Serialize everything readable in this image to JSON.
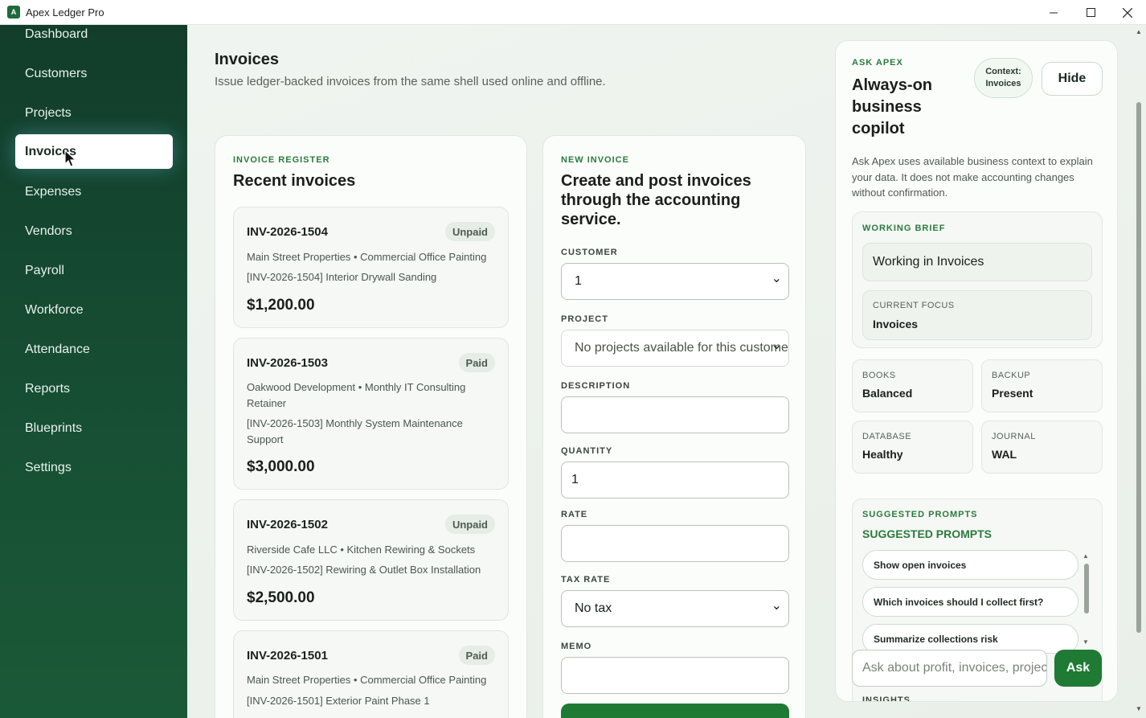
{
  "window": {
    "title": "Apex Ledger Pro",
    "icon_letter": "A"
  },
  "sidebar": {
    "items": [
      {
        "label": "Dashboard"
      },
      {
        "label": "Customers"
      },
      {
        "label": "Projects"
      },
      {
        "label": "Invoices",
        "active": true
      },
      {
        "label": "Expenses"
      },
      {
        "label": "Vendors"
      },
      {
        "label": "Payroll"
      },
      {
        "label": "Workforce"
      },
      {
        "label": "Attendance"
      },
      {
        "label": "Reports"
      },
      {
        "label": "Blueprints"
      },
      {
        "label": "Settings"
      }
    ]
  },
  "header": {
    "title": "Invoices",
    "subtitle": "Issue ledger-backed invoices from the same shell used online and offline."
  },
  "register": {
    "eyebrow": "INVOICE REGISTER",
    "title": "Recent invoices",
    "invoices": [
      {
        "number": "INV-2026-1504",
        "status": "Unpaid",
        "line1": "Main Street Properties • Commercial Office Painting",
        "line2": "[INV-2026-1504] Interior Drywall Sanding",
        "amount": "$1,200.00"
      },
      {
        "number": "INV-2026-1503",
        "status": "Paid",
        "line1": "Oakwood Development • Monthly IT Consulting Retainer",
        "line2": "[INV-2026-1503] Monthly System Maintenance Support",
        "amount": "$3,000.00"
      },
      {
        "number": "INV-2026-1502",
        "status": "Unpaid",
        "line1": "Riverside Cafe LLC • Kitchen Rewiring & Sockets",
        "line2": "[INV-2026-1502] Rewiring & Outlet Box Installation",
        "amount": "$2,500.00"
      },
      {
        "number": "INV-2026-1501",
        "status": "Paid",
        "line1": "Main Street Properties • Commercial Office Painting",
        "line2": "[INV-2026-1501] Exterior Paint Phase 1",
        "amount": ""
      }
    ]
  },
  "new_invoice": {
    "eyebrow": "NEW INVOICE",
    "title": "Create and post invoices through the accounting service.",
    "customer_label": "CUSTOMER",
    "customer_value": "1",
    "project_label": "PROJECT",
    "project_value": "No projects available for this customer",
    "description_label": "DESCRIPTION",
    "description_value": "",
    "quantity_label": "QUANTITY",
    "quantity_value": "1",
    "rate_label": "RATE",
    "rate_value": "",
    "tax_label": "TAX RATE",
    "tax_value": "No tax",
    "memo_label": "MEMO",
    "memo_value": ""
  },
  "ask": {
    "eyebrow": "ASK APEX",
    "title_line1": "Always-on",
    "title_line2": "business",
    "title_line3": "copilot",
    "context_label": "Context:",
    "context_value": "Invoices",
    "hide_label": "Hide",
    "description": "Ask Apex uses available business context to explain your data. It does not make accounting changes without confirmation.",
    "brief_eyebrow": "WORKING BRIEF",
    "brief_working": "Working in Invoices",
    "focus_label": "CURRENT FOCUS",
    "focus_value": "Invoices",
    "stats": [
      {
        "key": "BOOKS",
        "value": "Balanced"
      },
      {
        "key": "BACKUP",
        "value": "Present"
      },
      {
        "key": "DATABASE",
        "value": "Healthy"
      },
      {
        "key": "JOURNAL",
        "value": "WAL"
      }
    ],
    "prompts_eyebrow": "SUGGESTED PROMPTS",
    "prompts_title": "SUGGESTED PROMPTS",
    "prompts": [
      "Show open invoices",
      "Which invoices should I collect first?",
      "Summarize collections risk"
    ],
    "input_placeholder": "Ask about profit, invoices, projects",
    "ask_label": "Ask",
    "insights_label": "INSIGHTS"
  },
  "colors": {
    "sidebar": "#123d2b",
    "accent": "#1f7a33",
    "eyebrow": "#2b7a3d"
  },
  "icons": [
    "minimize-icon",
    "maximize-icon",
    "close-icon",
    "chevron-down-icon",
    "cursor-icon"
  ]
}
